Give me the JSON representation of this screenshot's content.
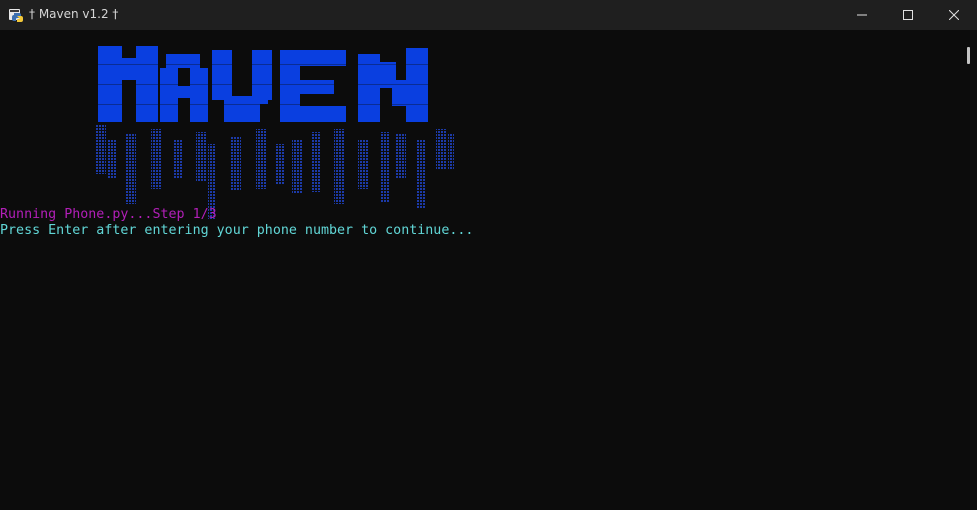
{
  "window": {
    "title": "† Maven v1.2 †",
    "app_icon": "python-icon"
  },
  "controls": {
    "minimize_icon": "minimize-icon",
    "maximize_icon": "maximize-icon",
    "close_icon": "close-icon"
  },
  "banner": {
    "text": "MAVEN",
    "color": "#0a3fe0",
    "drip_color": "#1a2f7a"
  },
  "terminal": {
    "background": "#0c0c0c",
    "lines": [
      {
        "text": "Running Phone.py...Step 1/3",
        "color": "#b21fb8"
      },
      {
        "text": "Press Enter after entering your phone number to continue...",
        "color": "#61d6d6"
      }
    ]
  }
}
